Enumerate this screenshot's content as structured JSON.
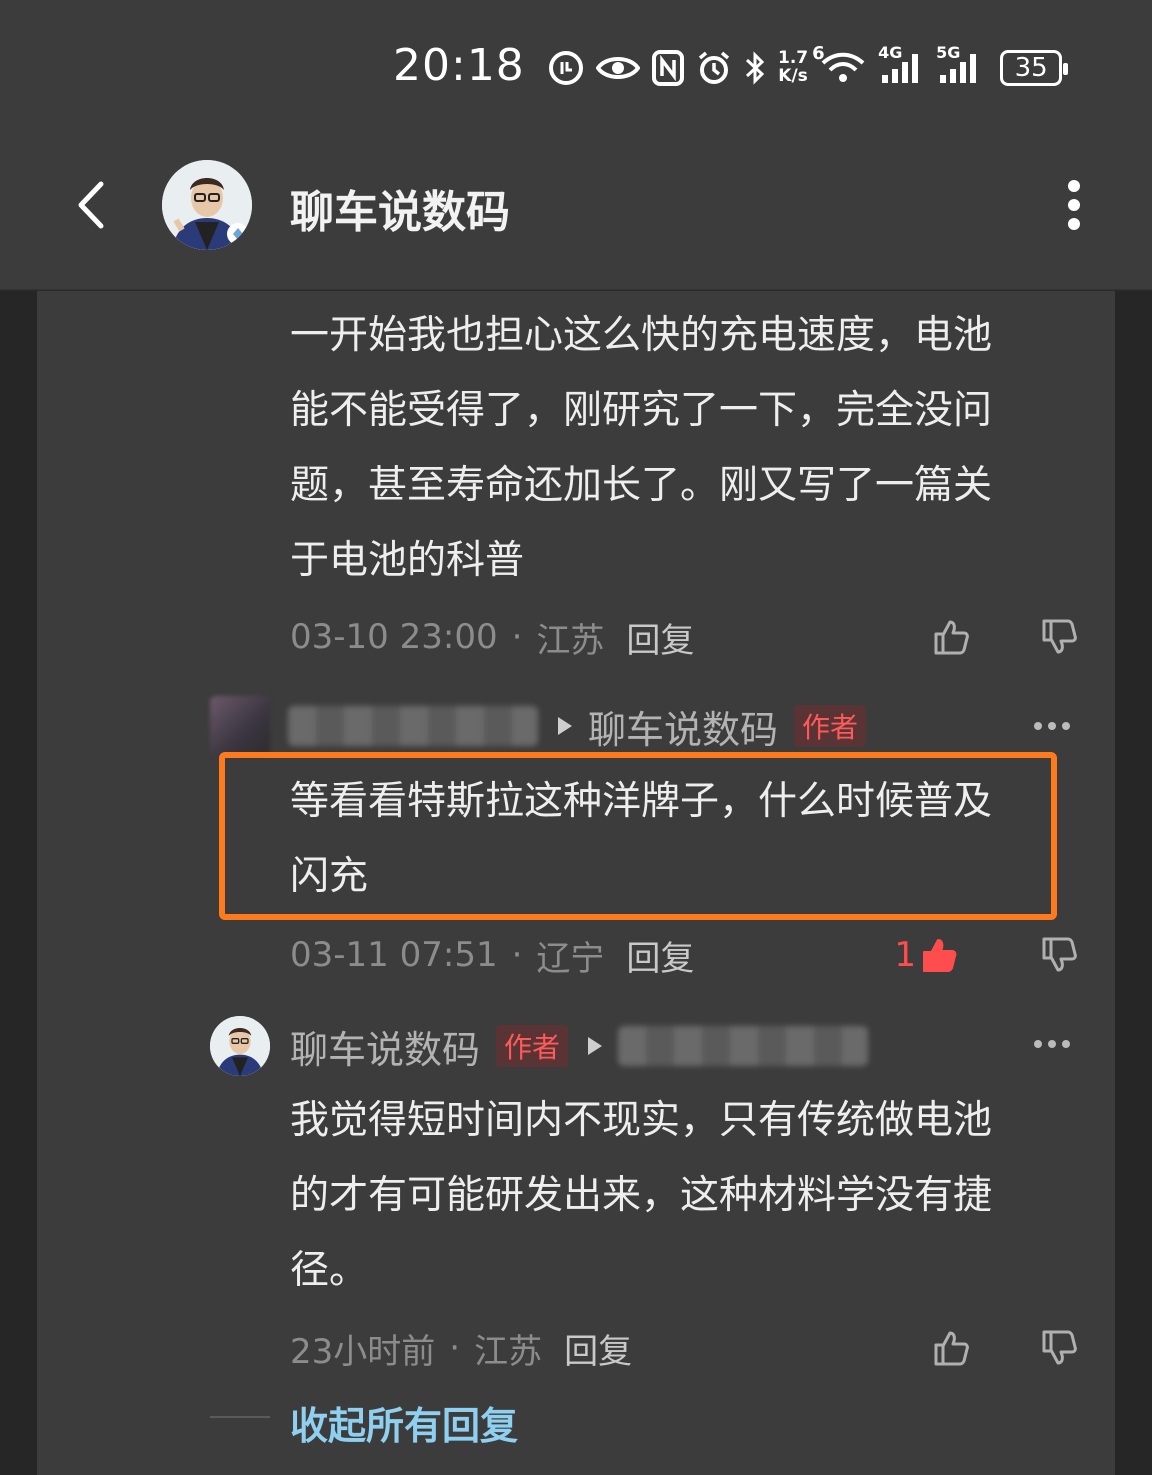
{
  "status_bar": {
    "time": "20:18",
    "icons": [
      "tiktok-icon",
      "eye-icon",
      "nfc-icon",
      "alarm-icon",
      "bluetooth-icon",
      "speed-icon",
      "wifi-icon",
      "signal-4g-icon",
      "signal-5g-icon",
      "battery-icon"
    ],
    "net_speed": "1.7\nK/s",
    "wifi_label": "6",
    "signal_4g": "4G",
    "signal_5g": "5G",
    "battery": "35"
  },
  "header": {
    "title": "聊车说数码"
  },
  "comments": [
    {
      "text": "一开始我也担心这么快的充电速度，电池能不能受得了，刚研究了一下，完全没问题，甚至寿命还加长了。刚又写了一篇关于电池的科普",
      "time": "03-10 23:00",
      "location": "江苏",
      "reply_label": "回复"
    },
    {
      "reply_to": "聊车说数码",
      "author_tag": "作者",
      "text": "等看看特斯拉这种洋牌子，什么时候普及闪充",
      "time": "03-11 07:51",
      "location": "辽宁",
      "reply_label": "回复",
      "likes": "1"
    },
    {
      "author": "聊车说数码",
      "author_tag": "作者",
      "text": "我觉得短时间内不现实，只有传统做电池的才有可能研发出来，这种材料学没有捷径。",
      "time": "23小时前",
      "location": "江苏",
      "reply_label": "回复"
    }
  ],
  "collapse_label": "收起所有回复",
  "colors": {
    "highlight": "#ff7a1c",
    "like_active": "#ff4d4d",
    "author_tag": "#ff5a5a",
    "link": "#8fd0f0"
  }
}
